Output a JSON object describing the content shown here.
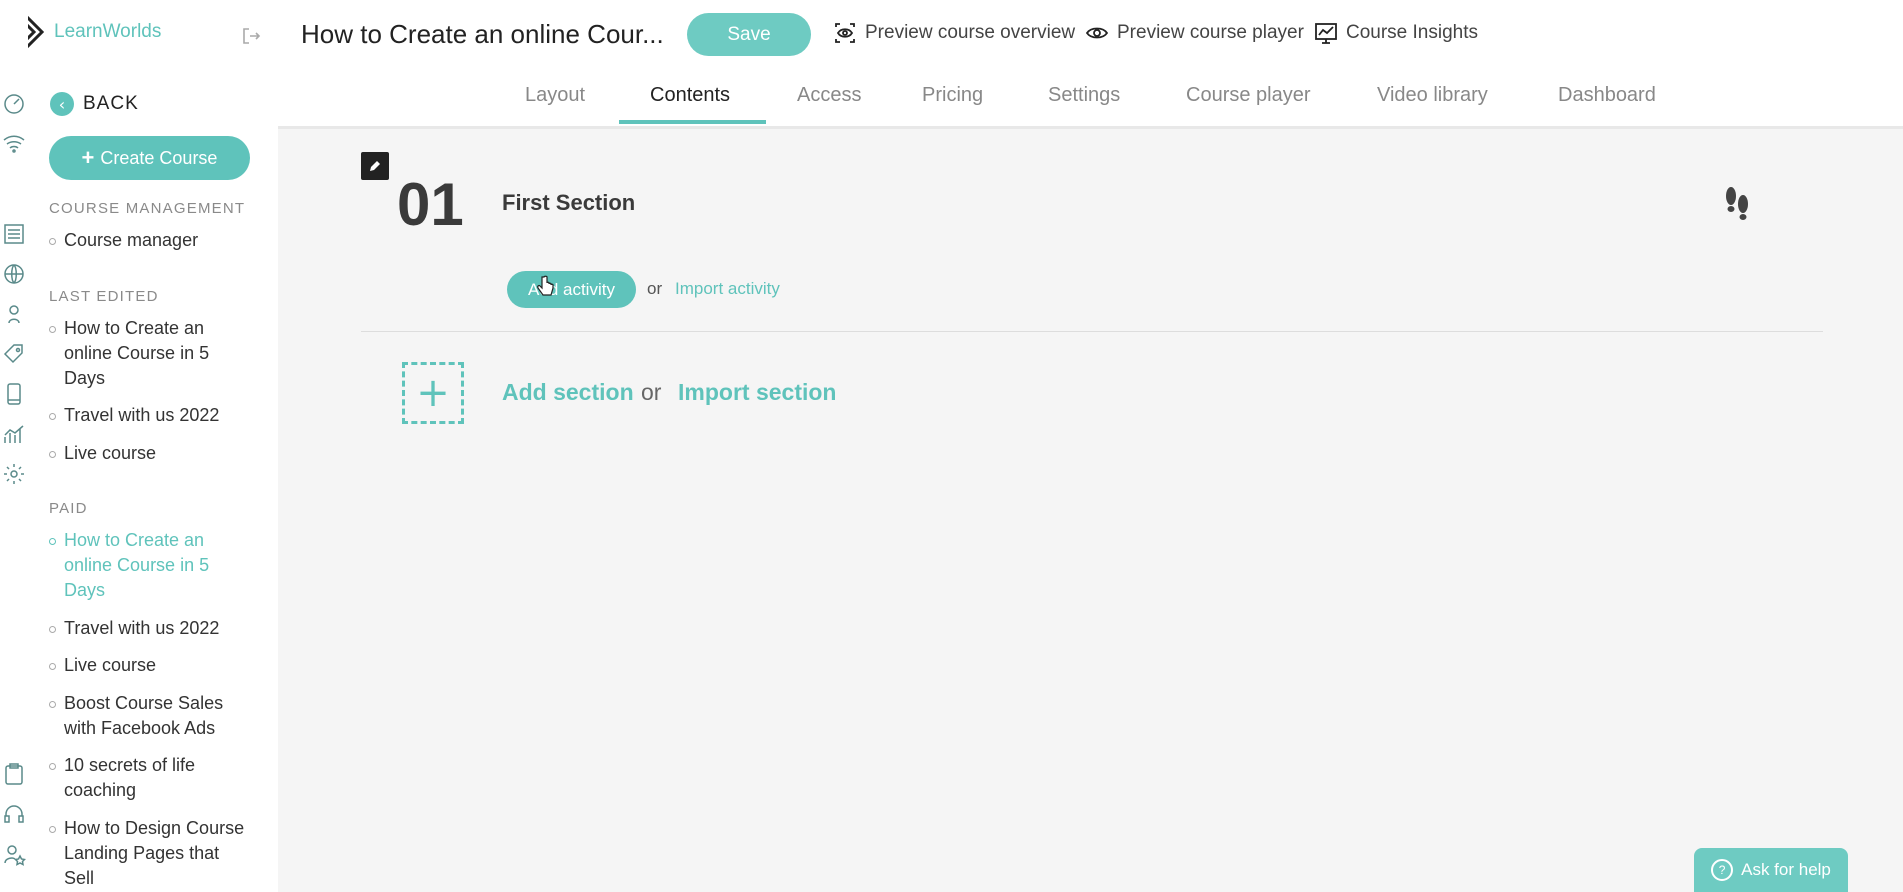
{
  "app": {
    "name": "LearnWorlds"
  },
  "sidebar": {
    "back_label": "BACK",
    "create_course_label": "Create Course",
    "course_management_heading": "COURSE MANAGEMENT",
    "course_management_items": [
      "Course manager"
    ],
    "last_edited_heading": "LAST EDITED",
    "last_edited_items": [
      "How to Create an online Course in 5 Days",
      "Travel with us 2022",
      "Live course"
    ],
    "paid_heading": "PAID",
    "paid_items": [
      "How to Create an online Course in 5 Days",
      "Travel with us 2022",
      "Live course",
      "Boost Course Sales with Facebook Ads",
      "10 secrets of life coaching",
      "How to Design Course Landing Pages that Sell"
    ]
  },
  "header": {
    "course_title": "How to Create an online Cour...",
    "save_label": "Save",
    "preview_overview_label": "Preview course overview",
    "preview_player_label": "Preview course player",
    "insights_label": "Course Insights"
  },
  "tabs": [
    "Layout",
    "Contents",
    "Access",
    "Pricing",
    "Settings",
    "Course player",
    "Video library",
    "Dashboard"
  ],
  "active_tab": "Contents",
  "main": {
    "section_number": "01",
    "section_title": "First Section",
    "add_activity_label": "Add activity",
    "or_label": "or",
    "import_activity_label": "Import activity",
    "add_section_label": "Add section",
    "import_section_label": "Import section"
  },
  "help": {
    "label": "Ask for help"
  },
  "colors": {
    "accent": "#5fc3bb",
    "accent_light": "#6ecbc2",
    "text": "#333333"
  }
}
